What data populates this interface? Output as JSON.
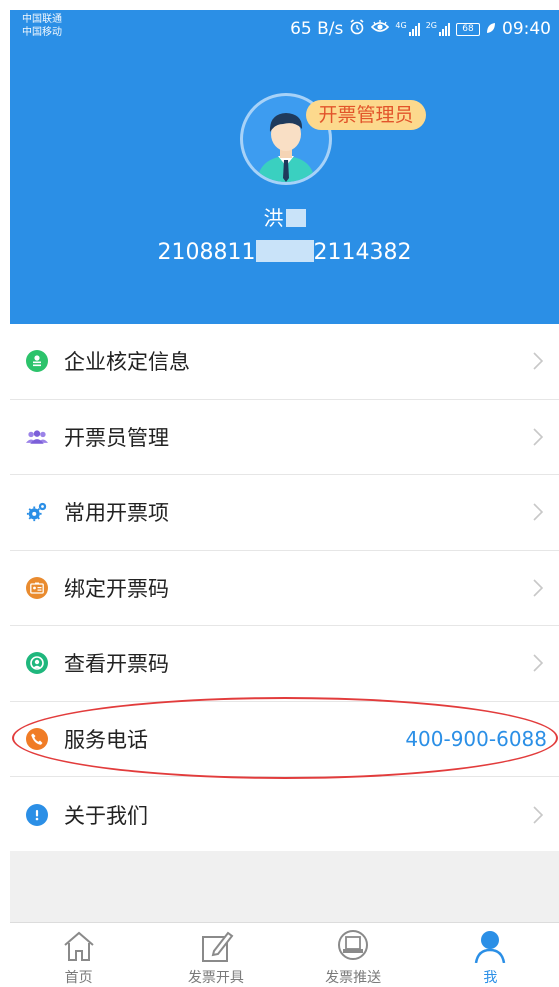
{
  "status_bar": {
    "carrier1": "中国联通",
    "carrier2": "中国移动",
    "net_speed": "65 B/s",
    "alarm_icon": "alarm-icon",
    "eye_icon": "eye-comfort-icon",
    "signal1_tech": "4G",
    "signal2_tech": "2G",
    "battery": "68",
    "time": "09:40"
  },
  "profile": {
    "role_badge": "开票管理员",
    "name": "洪",
    "id_prefix": "2108811",
    "id_suffix": "2114382"
  },
  "menu": {
    "items": [
      {
        "label": "企业核定信息",
        "icon": "enterprise-info-icon",
        "color": "#2cc36b"
      },
      {
        "label": "开票员管理",
        "icon": "users-group-icon",
        "color": "#8a6fe0"
      },
      {
        "label": "常用开票项",
        "icon": "gears-icon",
        "color": "#2b8fe6"
      },
      {
        "label": "绑定开票码",
        "icon": "id-card-icon",
        "color": "#e98b2f"
      },
      {
        "label": "查看开票码",
        "icon": "user-circle-icon",
        "color": "#1fb77d"
      },
      {
        "label": "服务电话",
        "value": "400-900-6088",
        "icon": "phone-icon",
        "color": "#f07c26"
      },
      {
        "label": "关于我们",
        "icon": "info-icon",
        "color": "#2b8fe6"
      }
    ]
  },
  "tabbar": {
    "tabs": [
      {
        "label": "首页",
        "icon": "home-icon"
      },
      {
        "label": "发票开具",
        "icon": "edit-invoice-icon"
      },
      {
        "label": "发票推送",
        "icon": "push-invoice-icon"
      },
      {
        "label": "我",
        "icon": "person-icon",
        "active": true
      }
    ]
  },
  "colors": {
    "primary": "#2b8fe6",
    "badge_bg": "#fcd98d",
    "badge_text": "#e2542a",
    "highlight": "#e23c3c"
  }
}
